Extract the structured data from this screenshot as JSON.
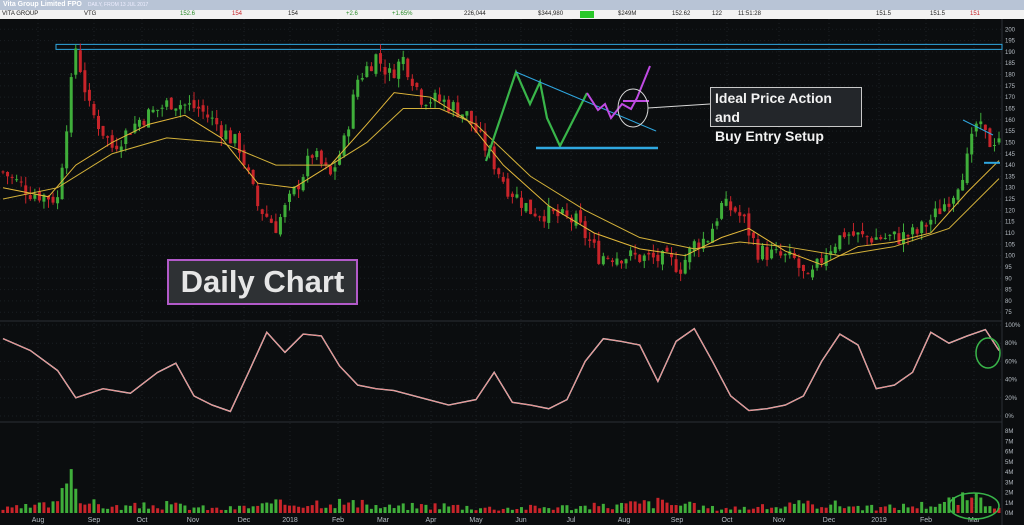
{
  "title_bar": {
    "name": "Vita Group Limited FPO",
    "sub": "DAILY, FROM 13 JUL 2017"
  },
  "quote_bar": {
    "company": "VITA GROUP",
    "code": "VTG",
    "last": "152.6",
    "bid": "154",
    "ask": "154",
    "change": "+2.6",
    "change_pct": "+1.65%",
    "volume": "226,044",
    "value": "$344,980",
    "mcap": "$249M",
    "vwap": "152.62",
    "trades": "122",
    "time": "11:51:28",
    "open": "151.5",
    "high": "151.5",
    "low": "151"
  },
  "annotations": {
    "daily_label": "Daily Chart",
    "setup_label_line1": "Ideal Price Action and",
    "setup_label_line2": "Buy Entry Setup"
  },
  "colors": {
    "up": "#3fae3a",
    "down": "#c8242a",
    "ma_fast": "#e2b73a",
    "ma_slow": "#d4b23a",
    "trendline": "#2fa7e0",
    "rsi": "#e87a7a",
    "label_border": "#b25ac9",
    "circle": "#39b54a"
  },
  "chart_data": {
    "type": "candlestick",
    "title": "",
    "x_tick_labels": [
      "Aug",
      "Sep",
      "Oct",
      "Nov",
      "Dec",
      "2018",
      "Feb",
      "Mar",
      "Apr",
      "May",
      "Jun",
      "Jul",
      "Aug",
      "Sep",
      "Oct",
      "Nov",
      "Dec",
      "2019",
      "Feb",
      "Mar"
    ],
    "price_axis": {
      "ticks": [
        75,
        80,
        85,
        90,
        95,
        100,
        105,
        110,
        115,
        120,
        125,
        130,
        135,
        140,
        145,
        150,
        155,
        160,
        165,
        170,
        175,
        180,
        185,
        190,
        195,
        200
      ],
      "ylim": [
        72,
        201
      ]
    },
    "rsi_axis": {
      "ticks": [
        "0%",
        "20%",
        "40%",
        "60%",
        "80%",
        "100%"
      ],
      "ylim": [
        0,
        100
      ]
    },
    "volume_axis": {
      "ticks": [
        "0M",
        "1M",
        "2M",
        "3M",
        "4M",
        "5M",
        "6M",
        "7M",
        "8M"
      ],
      "ylim": [
        0,
        8
      ]
    },
    "price_path": [
      [
        0,
        137
      ],
      [
        6,
        128
      ],
      [
        12,
        125
      ],
      [
        16,
        192
      ],
      [
        19,
        165
      ],
      [
        24,
        148
      ],
      [
        30,
        160
      ],
      [
        37,
        168
      ],
      [
        43,
        165
      ],
      [
        47,
        158
      ],
      [
        52,
        148
      ],
      [
        56,
        122
      ],
      [
        60,
        113
      ],
      [
        64,
        128
      ],
      [
        68,
        145
      ],
      [
        72,
        135
      ],
      [
        75,
        150
      ],
      [
        78,
        178
      ],
      [
        82,
        188
      ],
      [
        85,
        180
      ],
      [
        88,
        187
      ],
      [
        92,
        170
      ],
      [
        97,
        168
      ],
      [
        102,
        162
      ],
      [
        106,
        148
      ],
      [
        111,
        130
      ],
      [
        116,
        120
      ],
      [
        121,
        118
      ],
      [
        126,
        115
      ],
      [
        131,
        100
      ],
      [
        136,
        100
      ],
      [
        141,
        99
      ],
      [
        146,
        98
      ],
      [
        149,
        95
      ],
      [
        152,
        105
      ],
      [
        155,
        108
      ],
      [
        158,
        122
      ],
      [
        161,
        120
      ],
      [
        163,
        115
      ],
      [
        166,
        102
      ],
      [
        170,
        100
      ],
      [
        174,
        98
      ],
      [
        177,
        88
      ],
      [
        181,
        102
      ],
      [
        185,
        110
      ],
      [
        189,
        108
      ],
      [
        193,
        108
      ],
      [
        197,
        108
      ],
      [
        201,
        110
      ],
      [
        205,
        118
      ],
      [
        209,
        128
      ],
      [
        212,
        142
      ],
      [
        214,
        158
      ],
      [
        217,
        150
      ],
      [
        219,
        153
      ]
    ],
    "ma_fast_path": [
      [
        0,
        130
      ],
      [
        10,
        126
      ],
      [
        16,
        140
      ],
      [
        24,
        150
      ],
      [
        32,
        158
      ],
      [
        40,
        162
      ],
      [
        48,
        152
      ],
      [
        56,
        132
      ],
      [
        64,
        130
      ],
      [
        72,
        140
      ],
      [
        80,
        158
      ],
      [
        86,
        172
      ],
      [
        94,
        170
      ],
      [
        102,
        160
      ],
      [
        110,
        140
      ],
      [
        120,
        122
      ],
      [
        130,
        110
      ],
      [
        140,
        103
      ],
      [
        150,
        100
      ],
      [
        158,
        108
      ],
      [
        164,
        112
      ],
      [
        172,
        102
      ],
      [
        180,
        96
      ],
      [
        188,
        104
      ],
      [
        196,
        106
      ],
      [
        204,
        110
      ],
      [
        212,
        128
      ],
      [
        219,
        142
      ]
    ],
    "ma_slow_path": [
      [
        0,
        125
      ],
      [
        12,
        130
      ],
      [
        24,
        145
      ],
      [
        36,
        152
      ],
      [
        48,
        150
      ],
      [
        60,
        140
      ],
      [
        72,
        140
      ],
      [
        80,
        150
      ],
      [
        88,
        165
      ],
      [
        96,
        165
      ],
      [
        104,
        158
      ],
      [
        116,
        135
      ],
      [
        128,
        120
      ],
      [
        140,
        108
      ],
      [
        152,
        103
      ],
      [
        162,
        106
      ],
      [
        172,
        104
      ],
      [
        184,
        100
      ],
      [
        196,
        104
      ],
      [
        208,
        112
      ],
      [
        219,
        134
      ]
    ],
    "rsi_path": [
      [
        0,
        85
      ],
      [
        6,
        72
      ],
      [
        12,
        50
      ],
      [
        16,
        20
      ],
      [
        22,
        30
      ],
      [
        28,
        25
      ],
      [
        34,
        48
      ],
      [
        38,
        58
      ],
      [
        42,
        22
      ],
      [
        46,
        12
      ],
      [
        50,
        5
      ],
      [
        54,
        48
      ],
      [
        58,
        92
      ],
      [
        62,
        70
      ],
      [
        66,
        90
      ],
      [
        70,
        88
      ],
      [
        74,
        55
      ],
      [
        78,
        34
      ],
      [
        82,
        30
      ],
      [
        86,
        28
      ],
      [
        92,
        20
      ],
      [
        98,
        12
      ],
      [
        104,
        18
      ],
      [
        108,
        48
      ],
      [
        112,
        15
      ],
      [
        116,
        12
      ],
      [
        120,
        8
      ],
      [
        124,
        18
      ],
      [
        128,
        60
      ],
      [
        132,
        85
      ],
      [
        136,
        82
      ],
      [
        140,
        78
      ],
      [
        144,
        38
      ],
      [
        148,
        82
      ],
      [
        152,
        96
      ],
      [
        156,
        60
      ],
      [
        160,
        22
      ],
      [
        164,
        6
      ],
      [
        168,
        8
      ],
      [
        172,
        12
      ],
      [
        176,
        22
      ],
      [
        180,
        60
      ],
      [
        184,
        90
      ],
      [
        188,
        78
      ],
      [
        192,
        30
      ],
      [
        196,
        34
      ],
      [
        200,
        48
      ],
      [
        204,
        92
      ],
      [
        208,
        80
      ],
      [
        212,
        88
      ],
      [
        216,
        95
      ],
      [
        219,
        72
      ]
    ],
    "volume_path": [
      [
        0,
        0.4
      ],
      [
        12,
        0.9
      ],
      [
        14,
        5.6
      ],
      [
        18,
        1.1
      ],
      [
        24,
        0.6
      ],
      [
        36,
        0.8
      ],
      [
        48,
        0.4
      ],
      [
        60,
        0.9
      ],
      [
        72,
        1.2
      ],
      [
        84,
        0.6
      ],
      [
        96,
        0.8
      ],
      [
        108,
        0.5
      ],
      [
        120,
        0.6
      ],
      [
        132,
        0.7
      ],
      [
        144,
        1.1
      ],
      [
        156,
        0.5
      ],
      [
        168,
        0.6
      ],
      [
        180,
        1.0
      ],
      [
        192,
        0.5
      ],
      [
        204,
        0.9
      ],
      [
        212,
        1.5
      ],
      [
        219,
        1.0
      ]
    ],
    "resistance_level": 192,
    "support_level": 141
  }
}
